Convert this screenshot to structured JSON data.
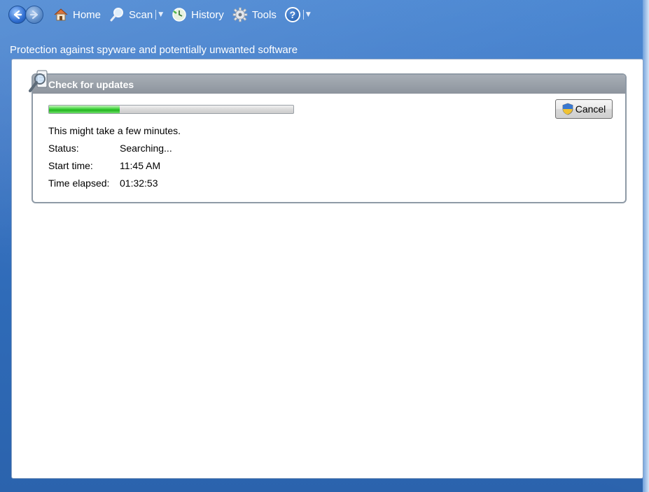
{
  "toolbar": {
    "home_label": "Home",
    "scan_label": "Scan",
    "history_label": "History",
    "tools_label": "Tools",
    "help_symbol": "?"
  },
  "header": {
    "subtitle": "Protection against spyware and potentially unwanted software"
  },
  "update_panel": {
    "title": "Check for updates",
    "progress_fraction": 0.29,
    "cancel_label": "Cancel",
    "message": "This might take a few minutes.",
    "status_label": "Status:",
    "status_value": "Searching...",
    "start_label": "Start time:",
    "start_value": "11:45 AM",
    "elapsed_label": "Time elapsed:",
    "elapsed_value": "01:32:53"
  },
  "icons": {
    "back": "back-arrow-icon",
    "forward": "forward-arrow-icon",
    "home": "home-icon",
    "scan": "magnifier-icon",
    "history": "clock-icon",
    "tools": "gear-icon",
    "help": "help-icon",
    "update": "magnifier-document-icon",
    "shield": "uac-shield-icon"
  },
  "colors": {
    "accent_blue": "#3b75c4",
    "progress_green": "#3fd23b",
    "panel_header": "#9aa1a9"
  }
}
